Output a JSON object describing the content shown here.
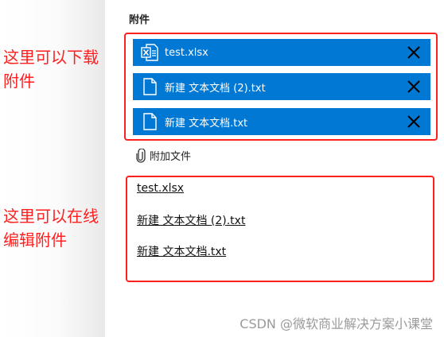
{
  "attachments_section": {
    "title": "附件",
    "items": [
      {
        "name": "test.xlsx",
        "icon": "excel-file-icon"
      },
      {
        "name": "新建 文本文档 (2).txt",
        "icon": "text-file-icon"
      },
      {
        "name": "新建 文本文档.txt",
        "icon": "text-file-icon"
      }
    ],
    "add_file_label": "附加文件"
  },
  "online_edit_links": [
    "test.xlsx",
    "新建 文本文档 (2).txt",
    "新建 文本文档.txt"
  ],
  "annotations": {
    "download_line1": "这里可以下载",
    "download_line2": "附件",
    "edit_line1": "这里可以在线",
    "edit_line2": "编辑附件"
  },
  "watermark": "CSDN @微软商业解决方案小课堂",
  "colors": {
    "accent": "#0078d4",
    "annotation_red": "#ff1f1f"
  }
}
